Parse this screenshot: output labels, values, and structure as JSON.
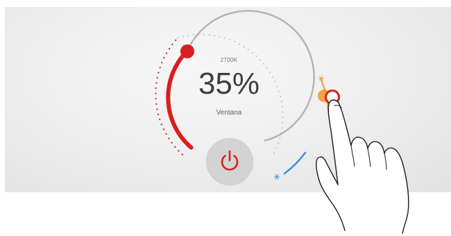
{
  "dial": {
    "color_temperature": "2700K",
    "level": "35%",
    "zone": "Ventana",
    "level_fraction": 0.35
  },
  "colors": {
    "accent": "#d81e1e",
    "track": "#b5b5b5",
    "warm": "#f39a2b",
    "cool": "#3a8fe0",
    "panel": "#efefef"
  },
  "icons": {
    "power": "power-icon",
    "sun": "sun-icon",
    "snowflake": "snowflake-icon",
    "hand": "hand-pointer-icon"
  }
}
